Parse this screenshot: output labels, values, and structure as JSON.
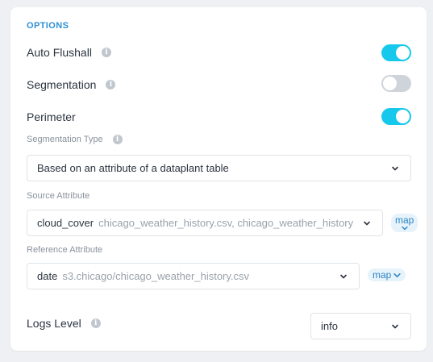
{
  "options": {
    "section_title": "OPTIONS",
    "auto_flushall": {
      "label": "Auto Flushall",
      "enabled": true
    },
    "segmentation": {
      "label": "Segmentation",
      "enabled": false
    },
    "perimeter": {
      "label": "Perimeter",
      "enabled": true
    },
    "segmentation_type": {
      "label": "Segmentation Type",
      "value": "Based on an attribute of a dataplant table"
    },
    "source_attribute": {
      "label": "Source Attribute",
      "value": "cloud_cover",
      "source": "chicago_weather_history.csv, chicago_weather_history",
      "map_label": "map"
    },
    "reference_attribute": {
      "label": "Reference Attribute",
      "value": "date",
      "source": "s3.chicago/chicago_weather_history.csv",
      "map_label": "map"
    },
    "logs_level": {
      "label": "Logs Level",
      "value": "info"
    }
  },
  "colors": {
    "accent": "#16c8ec",
    "toggle_off": "#cfd4da",
    "section_title": "#2e8fd6",
    "map_pill_bg": "#e6f3fb"
  },
  "icons": {
    "info": "info-icon",
    "dropdown": "chevron-down-icon"
  }
}
